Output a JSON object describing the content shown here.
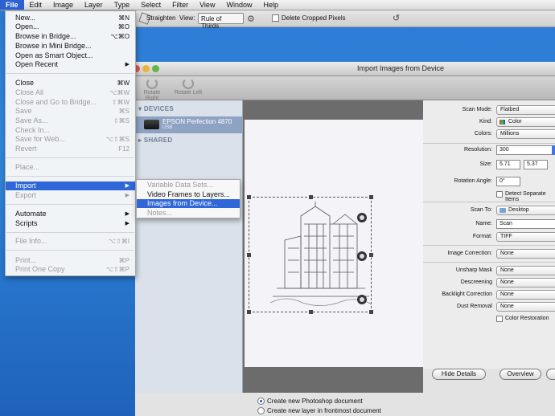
{
  "menubar": {
    "items": [
      {
        "label": "File"
      },
      {
        "label": "Edit"
      },
      {
        "label": "Image"
      },
      {
        "label": "Layer"
      },
      {
        "label": "Type"
      },
      {
        "label": "Select"
      },
      {
        "label": "Filter"
      },
      {
        "label": "View"
      },
      {
        "label": "Window"
      },
      {
        "label": "Help"
      }
    ]
  },
  "optbar": {
    "straighten": "Straighten",
    "view_label": "View:",
    "view_value": "Rule of Thirds",
    "delete_cropped": "Delete Cropped Pixels"
  },
  "file_menu": {
    "items": [
      {
        "label": "New...",
        "shortcut": "⌘N"
      },
      {
        "label": "Open...",
        "shortcut": "⌘O"
      },
      {
        "label": "Browse in Bridge...",
        "shortcut": "⌥⌘O"
      },
      {
        "label": "Browse in Mini Bridge..."
      },
      {
        "label": "Open as Smart Object..."
      },
      {
        "label": "Open Recent"
      },
      {
        "label": "Close",
        "shortcut": "⌘W"
      },
      {
        "label": "Close All",
        "shortcut": "⌥⌘W"
      },
      {
        "label": "Close and Go to Bridge...",
        "shortcut": "⇧⌘W"
      },
      {
        "label": "Save",
        "shortcut": "⌘S"
      },
      {
        "label": "Save As...",
        "shortcut": "⇧⌘S"
      },
      {
        "label": "Check In..."
      },
      {
        "label": "Save for Web...",
        "shortcut": "⌥⇧⌘S"
      },
      {
        "label": "Revert",
        "shortcut": "F12"
      },
      {
        "label": "Place..."
      },
      {
        "label": "Import"
      },
      {
        "label": "Export"
      },
      {
        "label": "Automate"
      },
      {
        "label": "Scripts"
      },
      {
        "label": "File Info...",
        "shortcut": "⌥⇧⌘I"
      },
      {
        "label": "Print...",
        "shortcut": "⌘P"
      },
      {
        "label": "Print One Copy",
        "shortcut": "⌥⇧⌘P"
      }
    ]
  },
  "import_submenu": {
    "items": [
      {
        "label": "Variable Data Sets..."
      },
      {
        "label": "Video Frames to Layers..."
      },
      {
        "label": "Images from Device..."
      },
      {
        "label": "Notes..."
      }
    ]
  },
  "dialog": {
    "title": "Import Images from Device",
    "toolbar": {
      "rotate_right": "Rotate Right",
      "rotate_left": "Rotate Left"
    },
    "sidebar": {
      "devices_header": "DEVICES",
      "device_name": "EPSON Perfection 4870",
      "device_sub": "USB",
      "shared_header": "SHARED"
    },
    "settings": {
      "scan_mode_label": "Scan Mode:",
      "scan_mode": "Flatbed",
      "kind_label": "Kind:",
      "kind": "Color",
      "colors_label": "Colors:",
      "colors": "Millions",
      "resolution_label": "Resolution:",
      "resolution": "300",
      "size_label": "Size:",
      "size_w": "5.71",
      "size_h": "5.37",
      "rotation_label": "Rotation Angle:",
      "rotation": "0°",
      "detect_label": "Detect Separate Items",
      "scan_to_label": "Scan To:",
      "scan_to": "Desktop",
      "name_label": "Name:",
      "name": "Scan",
      "format_label": "Format:",
      "format": "TIFF",
      "image_correction_label": "Image Correction:",
      "image_correction": "None",
      "unsharp_label": "Unsharp Mask",
      "unsharp": "None",
      "descreening_label": "Descreening",
      "descreening": "None",
      "backlight_label": "Backlight Correction",
      "backlight": "None",
      "dust_label": "Dust Removal",
      "dust": "None",
      "color_restoration_label": "Color Restoration"
    },
    "buttons": {
      "hide_details": "Hide Details",
      "overview": "Overview"
    },
    "options": {
      "new_doc": "Create new Photoshop document",
      "new_layer": "Create new layer in frontmost document"
    }
  }
}
